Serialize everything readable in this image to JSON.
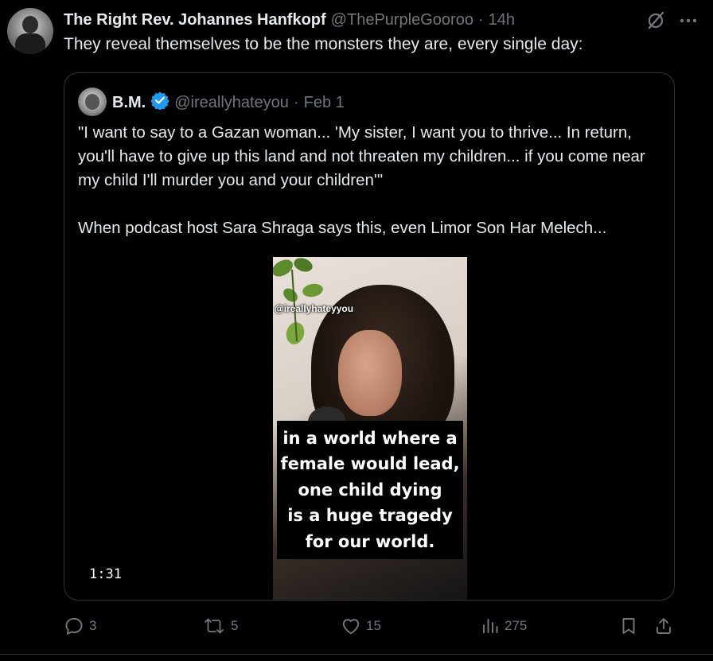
{
  "author": {
    "name": "The Right Rev. Johannes Hanfkopf",
    "handle": "@ThePurpleGooroo",
    "separator": "·",
    "time": "14h"
  },
  "tweet": {
    "text": "They reveal themselves to be the monsters they are, every single day:"
  },
  "top_icons": [
    "grok-icon",
    "more-icon"
  ],
  "quote": {
    "name": "B.M.",
    "verified": true,
    "handle": "@ireallyhateyou",
    "separator": "·",
    "date": "Feb 1",
    "paragraph1": "\"I want to say to a Gazan woman... 'My sister, I want you to thrive... In return, you'll have to give up this land and not threaten my children... if you come near my child I'll murder you and your children'\"",
    "paragraph2": "When podcast host Sara Shraga says this, even Limor Son Har Melech...",
    "video": {
      "watermark": "@ireallyhateyyou",
      "caption": [
        "in a world where a",
        "female would lead,",
        "one child dying",
        "is a huge tragedy",
        "for our world."
      ],
      "duration": "1:31"
    }
  },
  "actions": {
    "replies": "3",
    "reposts": "5",
    "likes": "15",
    "views": "275"
  },
  "colors": {
    "background": "#000000",
    "text": "#e7e9ea",
    "muted": "#71767b",
    "border": "#2f3336",
    "verified": "#1d9bf0"
  }
}
